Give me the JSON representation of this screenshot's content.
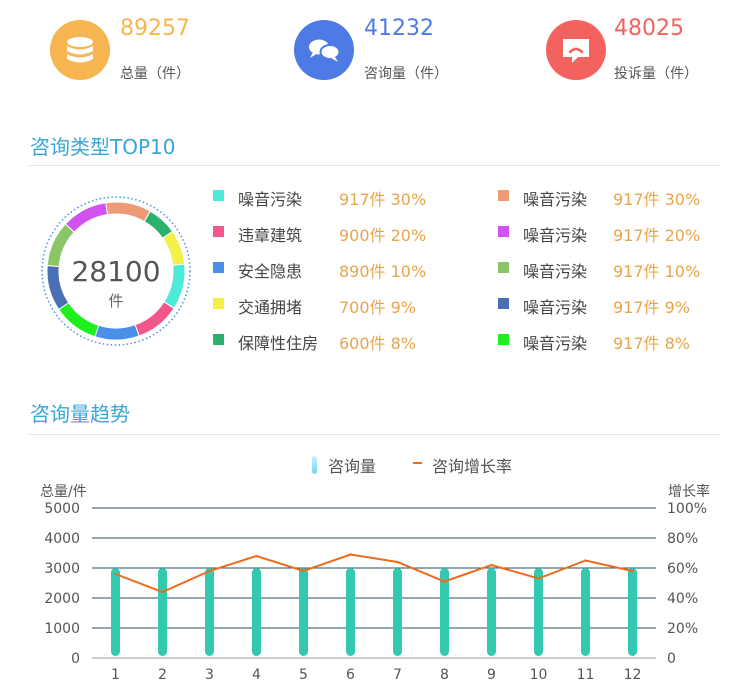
{
  "stats": [
    {
      "value": "89257",
      "label": "总量（件）",
      "color": "#f6b551",
      "icon": "database-icon"
    },
    {
      "value": "41232",
      "label": "咨询量（件）",
      "color": "#4d7ae5",
      "icon": "chat-bubbles-icon"
    },
    {
      "value": "48025",
      "label": "投诉量（件）",
      "color": "#f2625f",
      "icon": "complaint-icon"
    }
  ],
  "top10": {
    "title": "咨询类型TOP10",
    "donut_total": "28100",
    "donut_unit": "件",
    "items": [
      {
        "name": "噪音污染",
        "count": "917件",
        "pct": "30%",
        "color": "#4de9d9"
      },
      {
        "name": "违章建筑",
        "count": "900件",
        "pct": "20%",
        "color": "#f2578b"
      },
      {
        "name": "安全隐患",
        "count": "890件",
        "pct": "10%",
        "color": "#4a8fe8"
      },
      {
        "name": "交通拥堵",
        "count": "700件",
        "pct": "9%",
        "color": "#f4f04a"
      },
      {
        "name": "保障性住房",
        "count": "600件",
        "pct": "8%",
        "color": "#2bb06d"
      },
      {
        "name": "噪音污染",
        "count": "917件",
        "pct": "30%",
        "color": "#ef9a76"
      },
      {
        "name": "噪音污染",
        "count": "917件",
        "pct": "20%",
        "color": "#d152f0"
      },
      {
        "name": "噪音污染",
        "count": "917件",
        "pct": "10%",
        "color": "#8cc567"
      },
      {
        "name": "噪音污染",
        "count": "917件",
        "pct": "9%",
        "color": "#4b6fb5"
      },
      {
        "name": "噪音污染",
        "count": "917件",
        "pct": "8%",
        "color": "#1df01d"
      }
    ]
  },
  "trend": {
    "title": "咨询量趋势",
    "legend_bar": "咨询量",
    "legend_line": "咨询增长率",
    "bar_color": "#33c9b0",
    "line_color": "#ee6a1c"
  },
  "chart_data": [
    {
      "type": "pie",
      "title": "咨询类型TOP10",
      "center_label": "28100",
      "center_unit": "件",
      "slices": [
        {
          "label": "噪音污染",
          "value": 917
        },
        {
          "label": "违章建筑",
          "value": 900
        },
        {
          "label": "安全隐患",
          "value": 890
        },
        {
          "label": "交通拥堵",
          "value": 700
        },
        {
          "label": "保障性住房",
          "value": 600
        },
        {
          "label": "噪音污染",
          "value": 917
        },
        {
          "label": "噪音污染",
          "value": 917
        },
        {
          "label": "噪音污染",
          "value": 917
        },
        {
          "label": "噪音污染",
          "value": 917
        },
        {
          "label": "噪音污染",
          "value": 917
        }
      ]
    },
    {
      "type": "bar",
      "title": "咨询量趋势",
      "categories": [
        "1",
        "2",
        "3",
        "4",
        "5",
        "6",
        "7",
        "8",
        "9",
        "10",
        "11",
        "12"
      ],
      "series": [
        {
          "name": "咨询量",
          "type": "bar",
          "axis": "left",
          "values": [
            3000,
            3000,
            3000,
            3000,
            3000,
            3000,
            3000,
            3000,
            3000,
            3000,
            3000,
            3000
          ]
        },
        {
          "name": "咨询增长率",
          "type": "line",
          "axis": "right",
          "values": [
            56,
            44,
            58,
            68,
            58,
            69,
            64,
            51,
            62,
            53,
            65,
            58
          ]
        }
      ],
      "ylabel": "总量/件",
      "y2label": "增长率",
      "ylim": [
        0,
        5000
      ],
      "yticks": [
        "0",
        "1000",
        "2000",
        "3000",
        "4000",
        "5000"
      ],
      "y2lim": [
        0,
        100
      ],
      "y2ticks": [
        "0",
        "20%",
        "40%",
        "60%",
        "80%",
        "100%"
      ],
      "legend": "top-center",
      "grid": true
    }
  ]
}
